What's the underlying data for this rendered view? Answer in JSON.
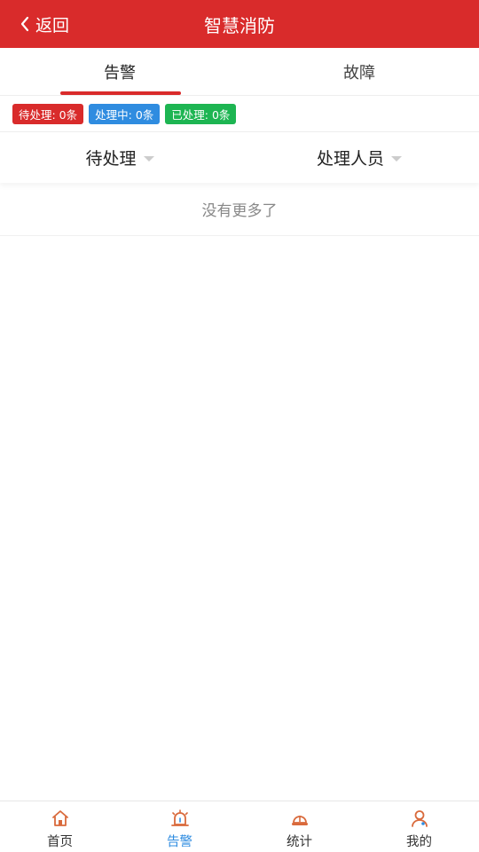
{
  "header": {
    "back_label": "返回",
    "title": "智慧消防"
  },
  "tabs": [
    {
      "label": "告警",
      "active": true
    },
    {
      "label": "故障",
      "active": false
    }
  ],
  "status_badges": {
    "pending": "待处理: 0条",
    "processing": "处理中: 0条",
    "done": "已处理: 0条"
  },
  "filters": {
    "status": "待处理",
    "handler": "处理人员"
  },
  "list": {
    "empty_text": "没有更多了"
  },
  "tabbar": [
    {
      "label": "首页",
      "icon": "home-icon"
    },
    {
      "label": "告警",
      "icon": "alarm-icon",
      "active": true
    },
    {
      "label": "统计",
      "icon": "helmet-icon"
    },
    {
      "label": "我的",
      "icon": "user-icon"
    }
  ],
  "colors": {
    "primary_red": "#d92b2b",
    "info_blue": "#2f8ce0",
    "success_green": "#1db552"
  }
}
